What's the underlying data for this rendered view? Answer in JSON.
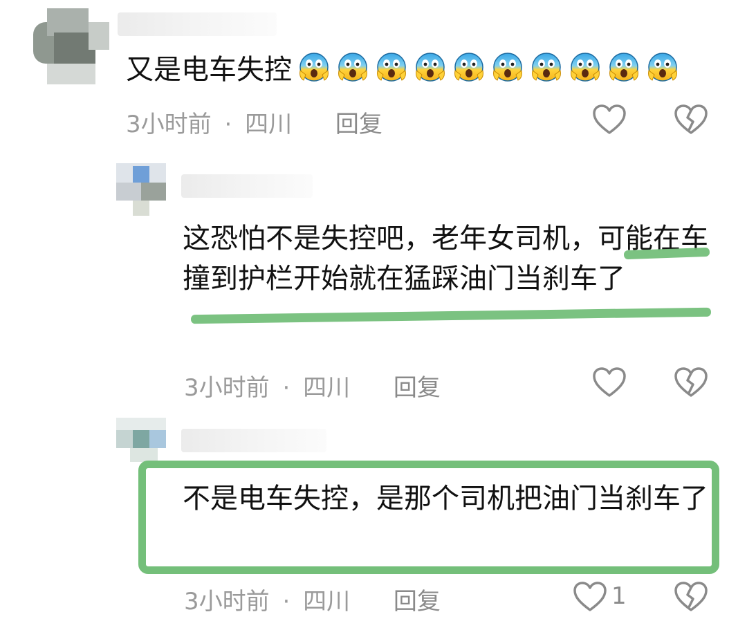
{
  "comments": [
    {
      "text": "又是电车失控",
      "emoji_count": 10,
      "emoji_icon": "face-screaming-in-fear-icon",
      "time": "3小时前",
      "sep": "·",
      "location": "四川",
      "reply_label": "回复",
      "likes": ""
    },
    {
      "text": "这恐怕不是失控吧，老年女司机，可能在车撞到护栏开始就在猛踩油门当刹车了",
      "time": "3小时前",
      "sep": "·",
      "location": "四川",
      "reply_label": "回复",
      "likes": ""
    },
    {
      "text": "不是电车失控，是那个司机把油门当刹车了",
      "time": "3小时前",
      "sep": "·",
      "location": "四川",
      "reply_label": "回复",
      "likes": "1"
    }
  ],
  "colors": {
    "highlight": "#74bf7a",
    "meta_text": "#9a9a9a",
    "icon_stroke": "#8a8a8a"
  }
}
